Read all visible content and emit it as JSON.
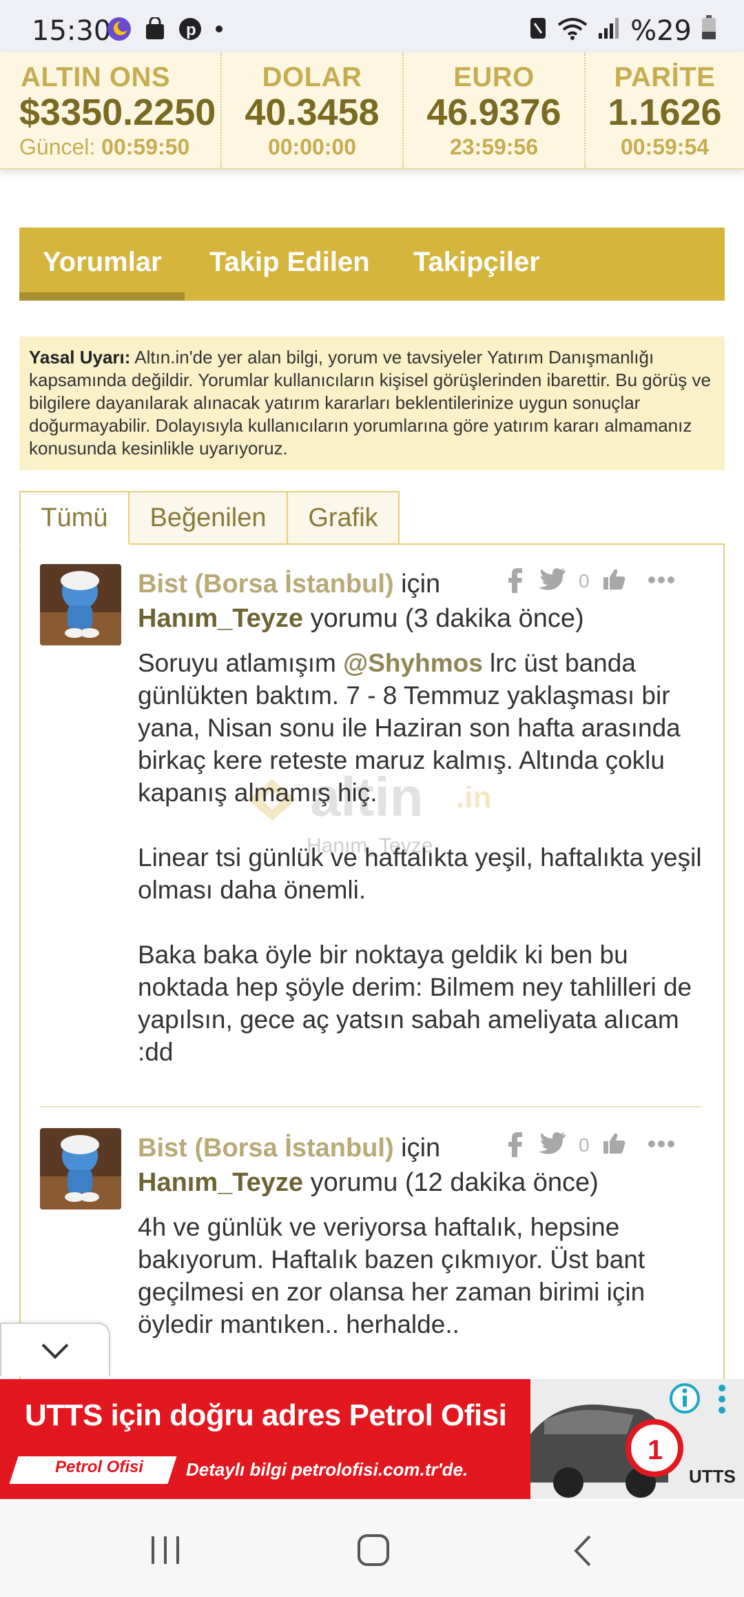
{
  "status_bar": {
    "time": "15:30",
    "battery_text": "%29",
    "icons": [
      "app-moon-icon",
      "shopping-bag-icon",
      "pinterest-icon",
      "dot-icon",
      "nfc-icon",
      "wifi-icon",
      "signal-icon",
      "battery-icon"
    ]
  },
  "ticker": [
    {
      "label": "ALTIN ONS",
      "value": "$3350.2250",
      "time_prefix": "Güncel:",
      "time": "00:59:50"
    },
    {
      "label": "DOLAR",
      "value": "40.3458",
      "time_prefix": "",
      "time": "00:00:00"
    },
    {
      "label": "EURO",
      "value": "46.9376",
      "time_prefix": "",
      "time": "23:59:56"
    },
    {
      "label": "PARİTE",
      "value": "1.1626",
      "time_prefix": "",
      "time": "00:59:54"
    }
  ],
  "main_tabs": [
    {
      "label": "Yorumlar",
      "active": true
    },
    {
      "label": "Takip Edilen",
      "active": false
    },
    {
      "label": "Takipçiler",
      "active": false
    }
  ],
  "disclaimer": {
    "title": "Yasal Uyarı:",
    "text": " Altın.in'de yer alan bilgi, yorum ve tavsiyeler Yatırım Danışmanlığı kapsamında değildir. Yorumlar kullanıcıların kişisel görüşlerinden ibarettir. Bu görüş ve bilgilere dayanılarak alınacak yatırım kararları beklentilerinize uygun sonuçlar doğurmayabilir. Dolayısıyla kullanıcıların yorumlarına göre yatırım kararı almamanız konusunda kesinlikle uyarıyoruz."
  },
  "sub_tabs": [
    {
      "label": "Tümü",
      "active": true
    },
    {
      "label": "Beğenilen",
      "active": false
    },
    {
      "label": "Grafik",
      "active": false
    }
  ],
  "comments": [
    {
      "topic": "Bist (Borsa İstanbul)",
      "for_word": " için",
      "user": "Hanım_Teyze",
      "meta": " yorumu (3 dakika önce)",
      "likes": "0",
      "text_before_mention": "Soruyu atlamışım ",
      "mention": "@Shyhmos",
      "text_after_mention": " lrc üst banda günlükten baktım. 7 - 8 Temmuz yaklaşması bir yana, Nisan sonu ile Haziran son hafta arasında birkaç kere reteste maruz kalmış. Altında çoklu kapanış almamış hiç.\n\nLinear tsi günlük ve haftalıkta yeşil, haftalıkta yeşil olması daha önemli.\n\nBaka baka öyle bir noktaya geldik ki ben bu noktada hep şöyle derim: Bilmem ney tahlilleri de yapılsın, gece aç yatsın sabah ameliyata alıcam :dd"
    },
    {
      "topic": "Bist (Borsa İstanbul)",
      "for_word": " için",
      "user": "Hanım_Teyze",
      "meta": " yorumu (12 dakika önce)",
      "likes": "0",
      "text": "4h ve günlük ve veriyorsa haftalık, hepsine bakıyorum. Haftalık bazen çıkmıyor. Üst bant geçilmesi en zor olansa her zaman birimi için öyledir mantıken.. herhalde.."
    }
  ],
  "watermark": {
    "logo_text": "altin",
    "logo_suffix": ".in",
    "caption": "Hanım_Teyze"
  },
  "ad": {
    "headline": "UTTS için doğru adres Petrol Ofisi",
    "brand": "Petrol Ofisi",
    "detail": "Detaylı bilgi petrolofisi.com.tr'de.",
    "badge_number": "1",
    "badge_text": "UTTS"
  },
  "colors": {
    "gold_bar": "#d6b53d",
    "ticker_bg": "#fdf7e2",
    "disclaimer_bg": "#fbf1c8",
    "ad_red": "#e3171f"
  }
}
